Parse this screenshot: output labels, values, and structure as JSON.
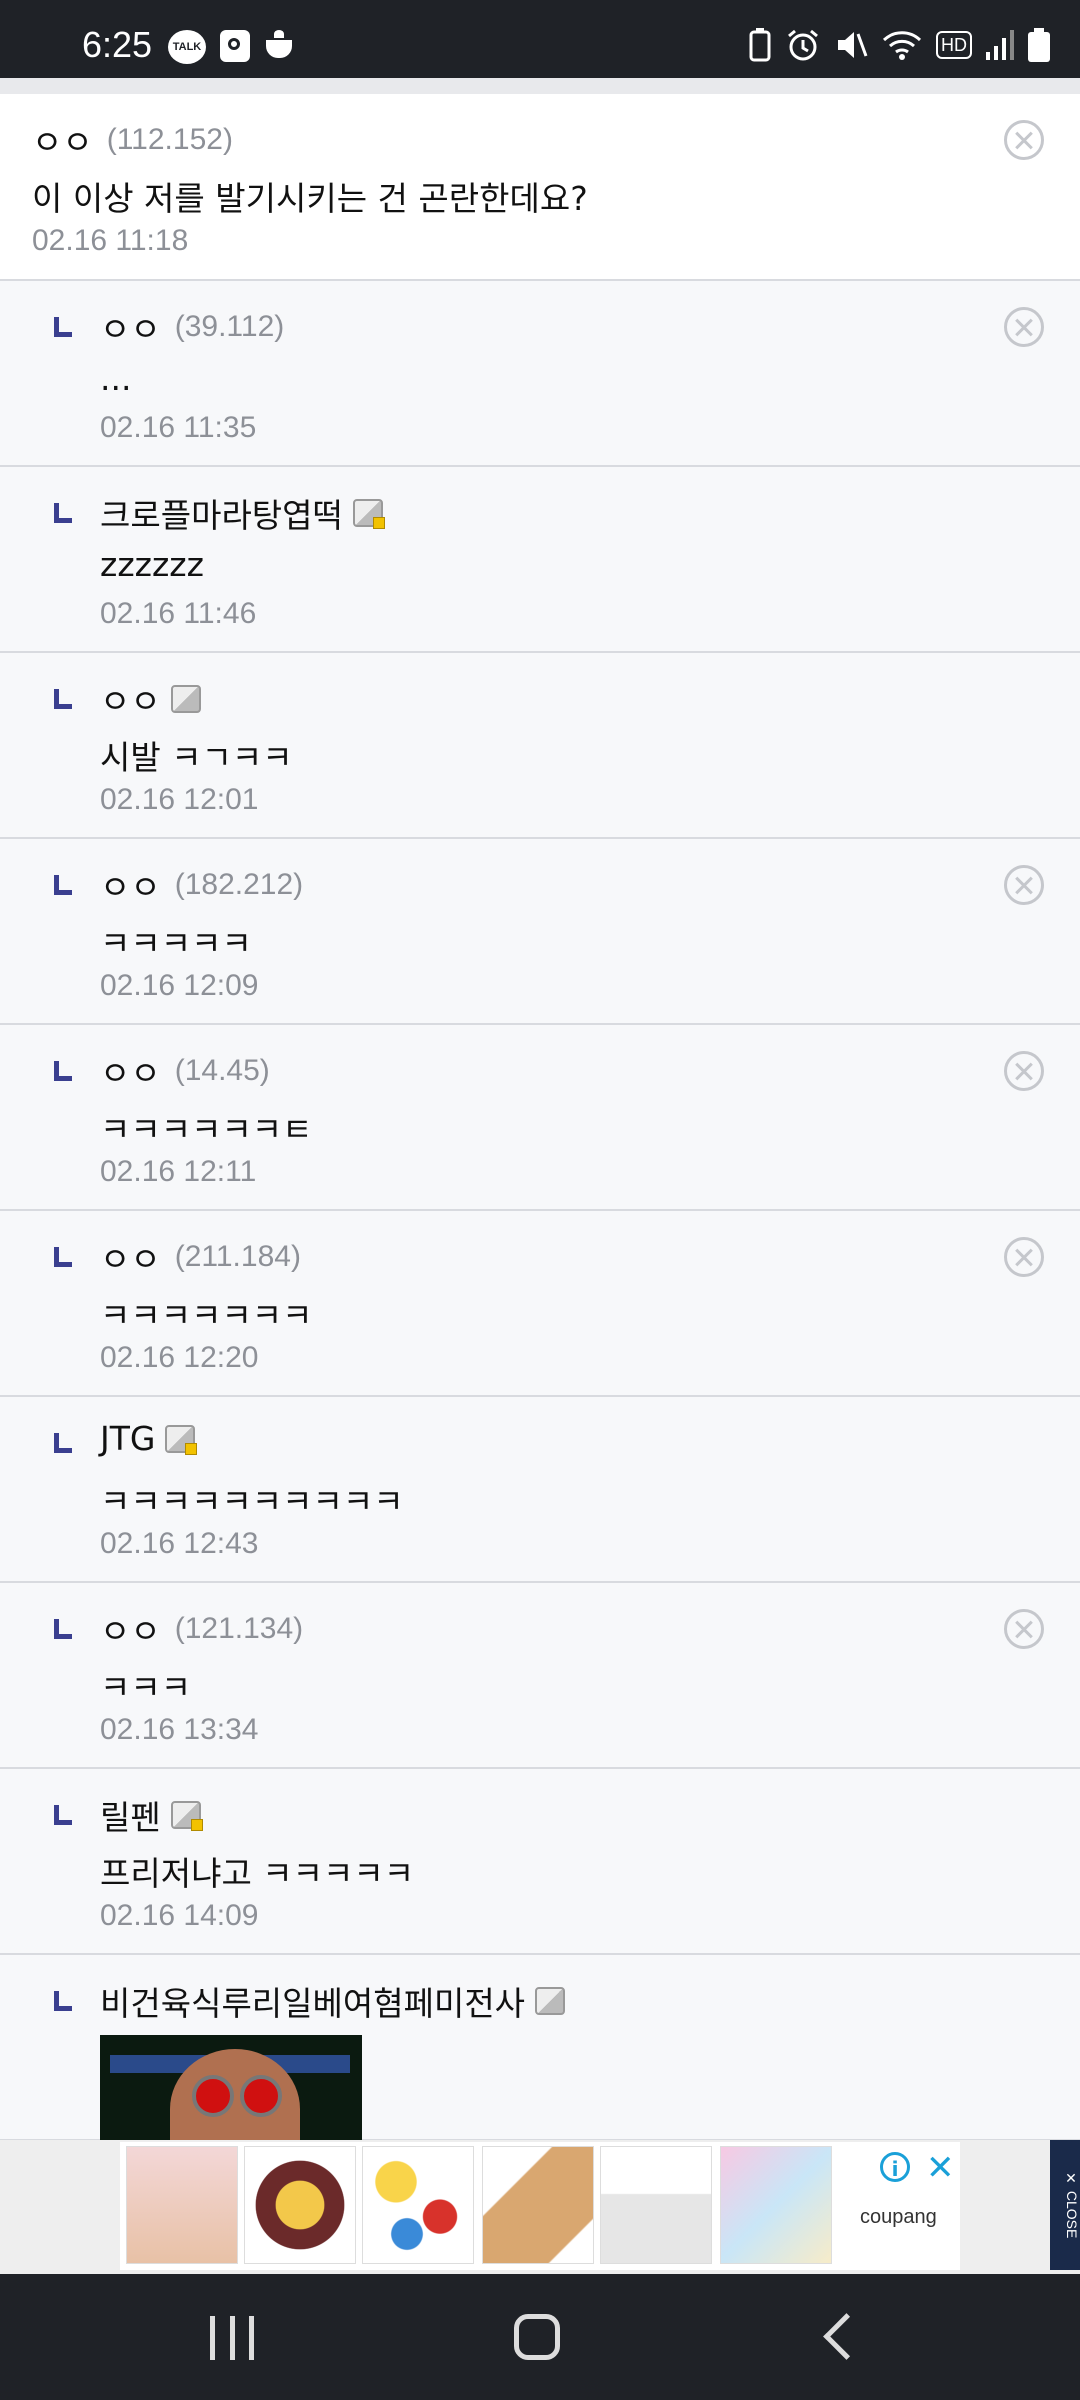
{
  "status_bar": {
    "time": "6:25",
    "talk_label": "TALK",
    "hd_label": "HD"
  },
  "comments": [
    {
      "name": "ㅇㅇ",
      "ip": "(112.152)",
      "text": "이 이상 저를 발기시키는 건 곤란한데요?",
      "time": "02.16 11:18",
      "reply": false,
      "badge": "none",
      "deletable": true
    },
    {
      "name": "ㅇㅇ",
      "ip": "(39.112)",
      "text": "...",
      "time": "02.16 11:35",
      "reply": true,
      "badge": "none",
      "deletable": true
    },
    {
      "name": "크로플마라탕엽떡",
      "ip": "",
      "text": "zzzzzz",
      "time": "02.16 11:46",
      "reply": true,
      "badge": "gold",
      "deletable": false
    },
    {
      "name": "ㅇㅇ",
      "ip": "",
      "text": "시발 ㅋㄱㅋㅋ",
      "time": "02.16 12:01",
      "reply": true,
      "badge": "plain",
      "deletable": false
    },
    {
      "name": "ㅇㅇ",
      "ip": "(182.212)",
      "text": "ㅋㅋㅋㅋㅋ",
      "time": "02.16 12:09",
      "reply": true,
      "badge": "none",
      "deletable": true
    },
    {
      "name": "ㅇㅇ",
      "ip": "(14.45)",
      "text": "ㅋㅋㅋㅋㅋㅋㅌ",
      "time": "02.16 12:11",
      "reply": true,
      "badge": "none",
      "deletable": true
    },
    {
      "name": "ㅇㅇ",
      "ip": "(211.184)",
      "text": "ㅋㅋㅋㅋㅋㅋㅋ",
      "time": "02.16 12:20",
      "reply": true,
      "badge": "none",
      "deletable": true
    },
    {
      "name": "JTG",
      "ip": "",
      "text": "ㅋㅋㅋㅋㅋㅋㅋㅋㅋㅋ",
      "time": "02.16 12:43",
      "reply": true,
      "badge": "gold",
      "deletable": false
    },
    {
      "name": "ㅇㅇ",
      "ip": "(121.134)",
      "text": "ㅋㅋㅋ",
      "time": "02.16 13:34",
      "reply": true,
      "badge": "none",
      "deletable": true
    },
    {
      "name": "릴펜",
      "ip": "",
      "text": "프리저냐고 ㅋㅋㅋㅋㅋ",
      "time": "02.16 14:09",
      "reply": true,
      "badge": "gold",
      "deletable": false
    },
    {
      "name": "비건육식루리일베여혐페미전사",
      "ip": "",
      "text": "",
      "time": "",
      "reply": true,
      "badge": "plain",
      "deletable": false,
      "has_image": true
    }
  ],
  "ad": {
    "brand": "coupang",
    "info_label": "i",
    "close_label": "✕",
    "side_close_label": "✕ CLOSE"
  }
}
